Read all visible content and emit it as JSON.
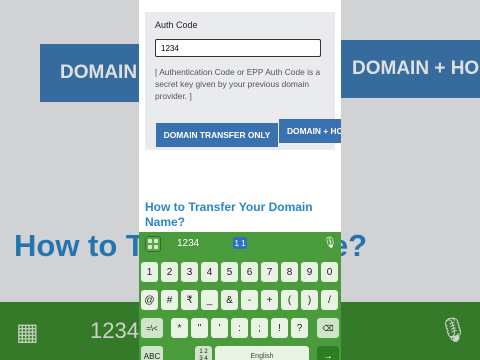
{
  "background": {
    "button_left": "DOMAIN T",
    "button_right": "DOMAIN + HO",
    "heading": "How to Tr      omain Name?",
    "keyboard_text": "1234"
  },
  "form": {
    "auth_label": "Auth Code",
    "auth_value": "1234",
    "hint": "[ Authentication Code or EPP Auth Code is a secret key given by your previous domain provider. ]",
    "btn_transfer": "DOMAIN TRANSFER ONLY",
    "btn_home": "DOMAIN + HO"
  },
  "section_title": "How to Transfer Your Domain Name?",
  "keyboard": {
    "typed": "1234",
    "suggestion_badge": "1 1",
    "row_numbers": [
      "1",
      "2",
      "3",
      "4",
      "5",
      "6",
      "7",
      "8",
      "9",
      "0"
    ],
    "row_symbols1": [
      "@",
      "#",
      "₹",
      "_",
      "&",
      "-",
      "+",
      "(",
      ")",
      "/"
    ],
    "row_symbols2": [
      "=\\<",
      "*",
      "\"",
      "'",
      ":",
      ";",
      "!",
      "?",
      "⌫"
    ],
    "row_bottom": [
      "ABC",
      "1 2\n3 4",
      "English",
      "→"
    ],
    "colors": {
      "keyboard": "#4a9b3b",
      "key": "#e8f3e4",
      "accent_blue": "#3a72b0",
      "link_blue": "#2a86c8"
    }
  }
}
